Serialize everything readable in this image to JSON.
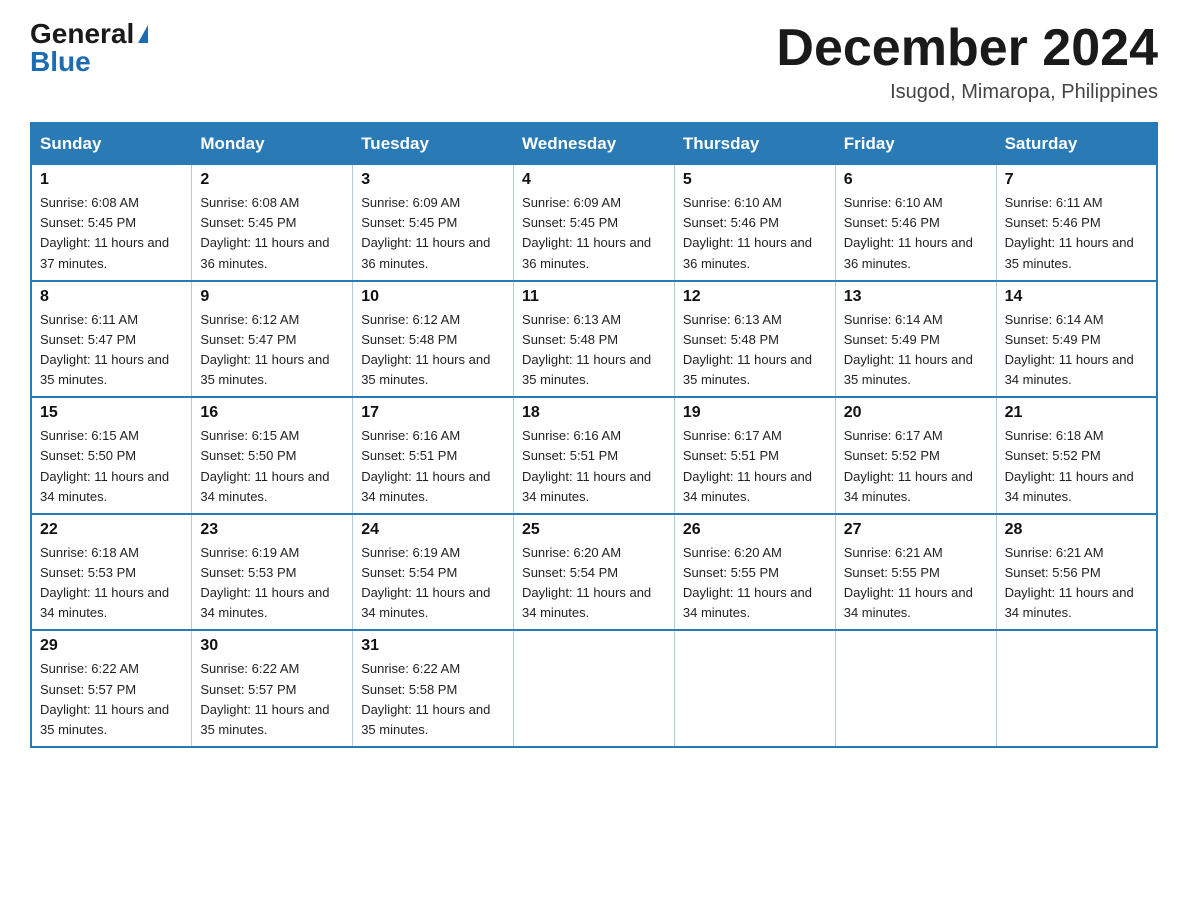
{
  "logo": {
    "general": "General",
    "blue": "Blue"
  },
  "header": {
    "month": "December 2024",
    "location": "Isugod, Mimaropa, Philippines"
  },
  "days_of_week": [
    "Sunday",
    "Monday",
    "Tuesday",
    "Wednesday",
    "Thursday",
    "Friday",
    "Saturday"
  ],
  "weeks": [
    [
      {
        "day": "1",
        "sunrise": "6:08 AM",
        "sunset": "5:45 PM",
        "daylight": "11 hours and 37 minutes."
      },
      {
        "day": "2",
        "sunrise": "6:08 AM",
        "sunset": "5:45 PM",
        "daylight": "11 hours and 36 minutes."
      },
      {
        "day": "3",
        "sunrise": "6:09 AM",
        "sunset": "5:45 PM",
        "daylight": "11 hours and 36 minutes."
      },
      {
        "day": "4",
        "sunrise": "6:09 AM",
        "sunset": "5:45 PM",
        "daylight": "11 hours and 36 minutes."
      },
      {
        "day": "5",
        "sunrise": "6:10 AM",
        "sunset": "5:46 PM",
        "daylight": "11 hours and 36 minutes."
      },
      {
        "day": "6",
        "sunrise": "6:10 AM",
        "sunset": "5:46 PM",
        "daylight": "11 hours and 36 minutes."
      },
      {
        "day": "7",
        "sunrise": "6:11 AM",
        "sunset": "5:46 PM",
        "daylight": "11 hours and 35 minutes."
      }
    ],
    [
      {
        "day": "8",
        "sunrise": "6:11 AM",
        "sunset": "5:47 PM",
        "daylight": "11 hours and 35 minutes."
      },
      {
        "day": "9",
        "sunrise": "6:12 AM",
        "sunset": "5:47 PM",
        "daylight": "11 hours and 35 minutes."
      },
      {
        "day": "10",
        "sunrise": "6:12 AM",
        "sunset": "5:48 PM",
        "daylight": "11 hours and 35 minutes."
      },
      {
        "day": "11",
        "sunrise": "6:13 AM",
        "sunset": "5:48 PM",
        "daylight": "11 hours and 35 minutes."
      },
      {
        "day": "12",
        "sunrise": "6:13 AM",
        "sunset": "5:48 PM",
        "daylight": "11 hours and 35 minutes."
      },
      {
        "day": "13",
        "sunrise": "6:14 AM",
        "sunset": "5:49 PM",
        "daylight": "11 hours and 35 minutes."
      },
      {
        "day": "14",
        "sunrise": "6:14 AM",
        "sunset": "5:49 PM",
        "daylight": "11 hours and 34 minutes."
      }
    ],
    [
      {
        "day": "15",
        "sunrise": "6:15 AM",
        "sunset": "5:50 PM",
        "daylight": "11 hours and 34 minutes."
      },
      {
        "day": "16",
        "sunrise": "6:15 AM",
        "sunset": "5:50 PM",
        "daylight": "11 hours and 34 minutes."
      },
      {
        "day": "17",
        "sunrise": "6:16 AM",
        "sunset": "5:51 PM",
        "daylight": "11 hours and 34 minutes."
      },
      {
        "day": "18",
        "sunrise": "6:16 AM",
        "sunset": "5:51 PM",
        "daylight": "11 hours and 34 minutes."
      },
      {
        "day": "19",
        "sunrise": "6:17 AM",
        "sunset": "5:51 PM",
        "daylight": "11 hours and 34 minutes."
      },
      {
        "day": "20",
        "sunrise": "6:17 AM",
        "sunset": "5:52 PM",
        "daylight": "11 hours and 34 minutes."
      },
      {
        "day": "21",
        "sunrise": "6:18 AM",
        "sunset": "5:52 PM",
        "daylight": "11 hours and 34 minutes."
      }
    ],
    [
      {
        "day": "22",
        "sunrise": "6:18 AM",
        "sunset": "5:53 PM",
        "daylight": "11 hours and 34 minutes."
      },
      {
        "day": "23",
        "sunrise": "6:19 AM",
        "sunset": "5:53 PM",
        "daylight": "11 hours and 34 minutes."
      },
      {
        "day": "24",
        "sunrise": "6:19 AM",
        "sunset": "5:54 PM",
        "daylight": "11 hours and 34 minutes."
      },
      {
        "day": "25",
        "sunrise": "6:20 AM",
        "sunset": "5:54 PM",
        "daylight": "11 hours and 34 minutes."
      },
      {
        "day": "26",
        "sunrise": "6:20 AM",
        "sunset": "5:55 PM",
        "daylight": "11 hours and 34 minutes."
      },
      {
        "day": "27",
        "sunrise": "6:21 AM",
        "sunset": "5:55 PM",
        "daylight": "11 hours and 34 minutes."
      },
      {
        "day": "28",
        "sunrise": "6:21 AM",
        "sunset": "5:56 PM",
        "daylight": "11 hours and 34 minutes."
      }
    ],
    [
      {
        "day": "29",
        "sunrise": "6:22 AM",
        "sunset": "5:57 PM",
        "daylight": "11 hours and 35 minutes."
      },
      {
        "day": "30",
        "sunrise": "6:22 AM",
        "sunset": "5:57 PM",
        "daylight": "11 hours and 35 minutes."
      },
      {
        "day": "31",
        "sunrise": "6:22 AM",
        "sunset": "5:58 PM",
        "daylight": "11 hours and 35 minutes."
      },
      null,
      null,
      null,
      null
    ]
  ]
}
